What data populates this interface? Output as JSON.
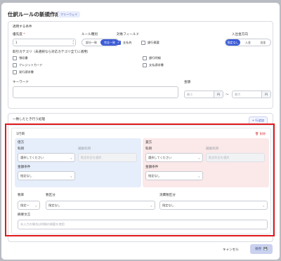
{
  "dialog": {
    "title": "仕訳ルールの新規作成",
    "badge": "フリーウェイ"
  },
  "conditions": {
    "section_label": "適用する条件",
    "priority": {
      "label": "優先度",
      "required_mark": "*",
      "value": "1"
    },
    "rule_type": {
      "label": "ルール種別",
      "options": [
        "部分一致",
        "完全一致"
      ],
      "selected": "完全一致"
    },
    "target_field": {
      "label": "対象フィールド",
      "options": [
        {
          "label": "支払先",
          "checked": true
        },
        {
          "label": "銀行摘要",
          "checked": false
        }
      ]
    },
    "direction": {
      "label": "入出金方向",
      "options": [
        "指定なし",
        "入金",
        "出金"
      ],
      "selected": "指定なし"
    },
    "categories": {
      "label": "取引カテゴリ（未選択なら対応カテゴリ全てに適用）",
      "items": [
        {
          "label": "領収書",
          "checked": false
        },
        {
          "label": "クレジットカード",
          "checked": false
        },
        {
          "label": "発行請求書",
          "checked": false
        },
        {
          "label": "銀行明細",
          "checked": false
        },
        {
          "label": "支払請求書",
          "checked": false
        }
      ]
    },
    "keyword": {
      "label": "キーワード",
      "value": ""
    },
    "amount": {
      "label": "金額",
      "min_placeholder": "最小",
      "max_placeholder": "最大",
      "unit": "円",
      "separator": "〜"
    }
  },
  "actions": {
    "section_label": "一致したとき行う処理",
    "add_row_label": "+ 行追加",
    "row": {
      "title": "1行目",
      "delete_label": "削除",
      "debit": {
        "title": "借方",
        "account_label": "科目",
        "account_placeholder": "選択してください",
        "sub_account_label": "補助科目",
        "sub_account_placeholder": "勘定科目を選択",
        "amount_condition_label": "金額条件",
        "amount_condition_value": "指定なし"
      },
      "credit": {
        "title": "貸方",
        "account_label": "科目",
        "account_placeholder": "選択してください",
        "sub_account_label": "補助科目",
        "sub_account_placeholder": "勘定科目を選択",
        "amount_condition_label": "金額条件",
        "amount_condition_value": "指定なし"
      },
      "tax_rate": {
        "label": "税率",
        "value": "指定一"
      },
      "tax_category": {
        "label": "税区分",
        "value": "指定なし"
      },
      "consumption_tax": {
        "label": "消費税区分",
        "value": "指定なし"
      },
      "memo": {
        "label": "摘要文言",
        "placeholder": "未入力の場合は明細の摘要を使用"
      }
    }
  },
  "footer": {
    "cancel_label": "キャンセル",
    "save_label": "保存"
  }
}
